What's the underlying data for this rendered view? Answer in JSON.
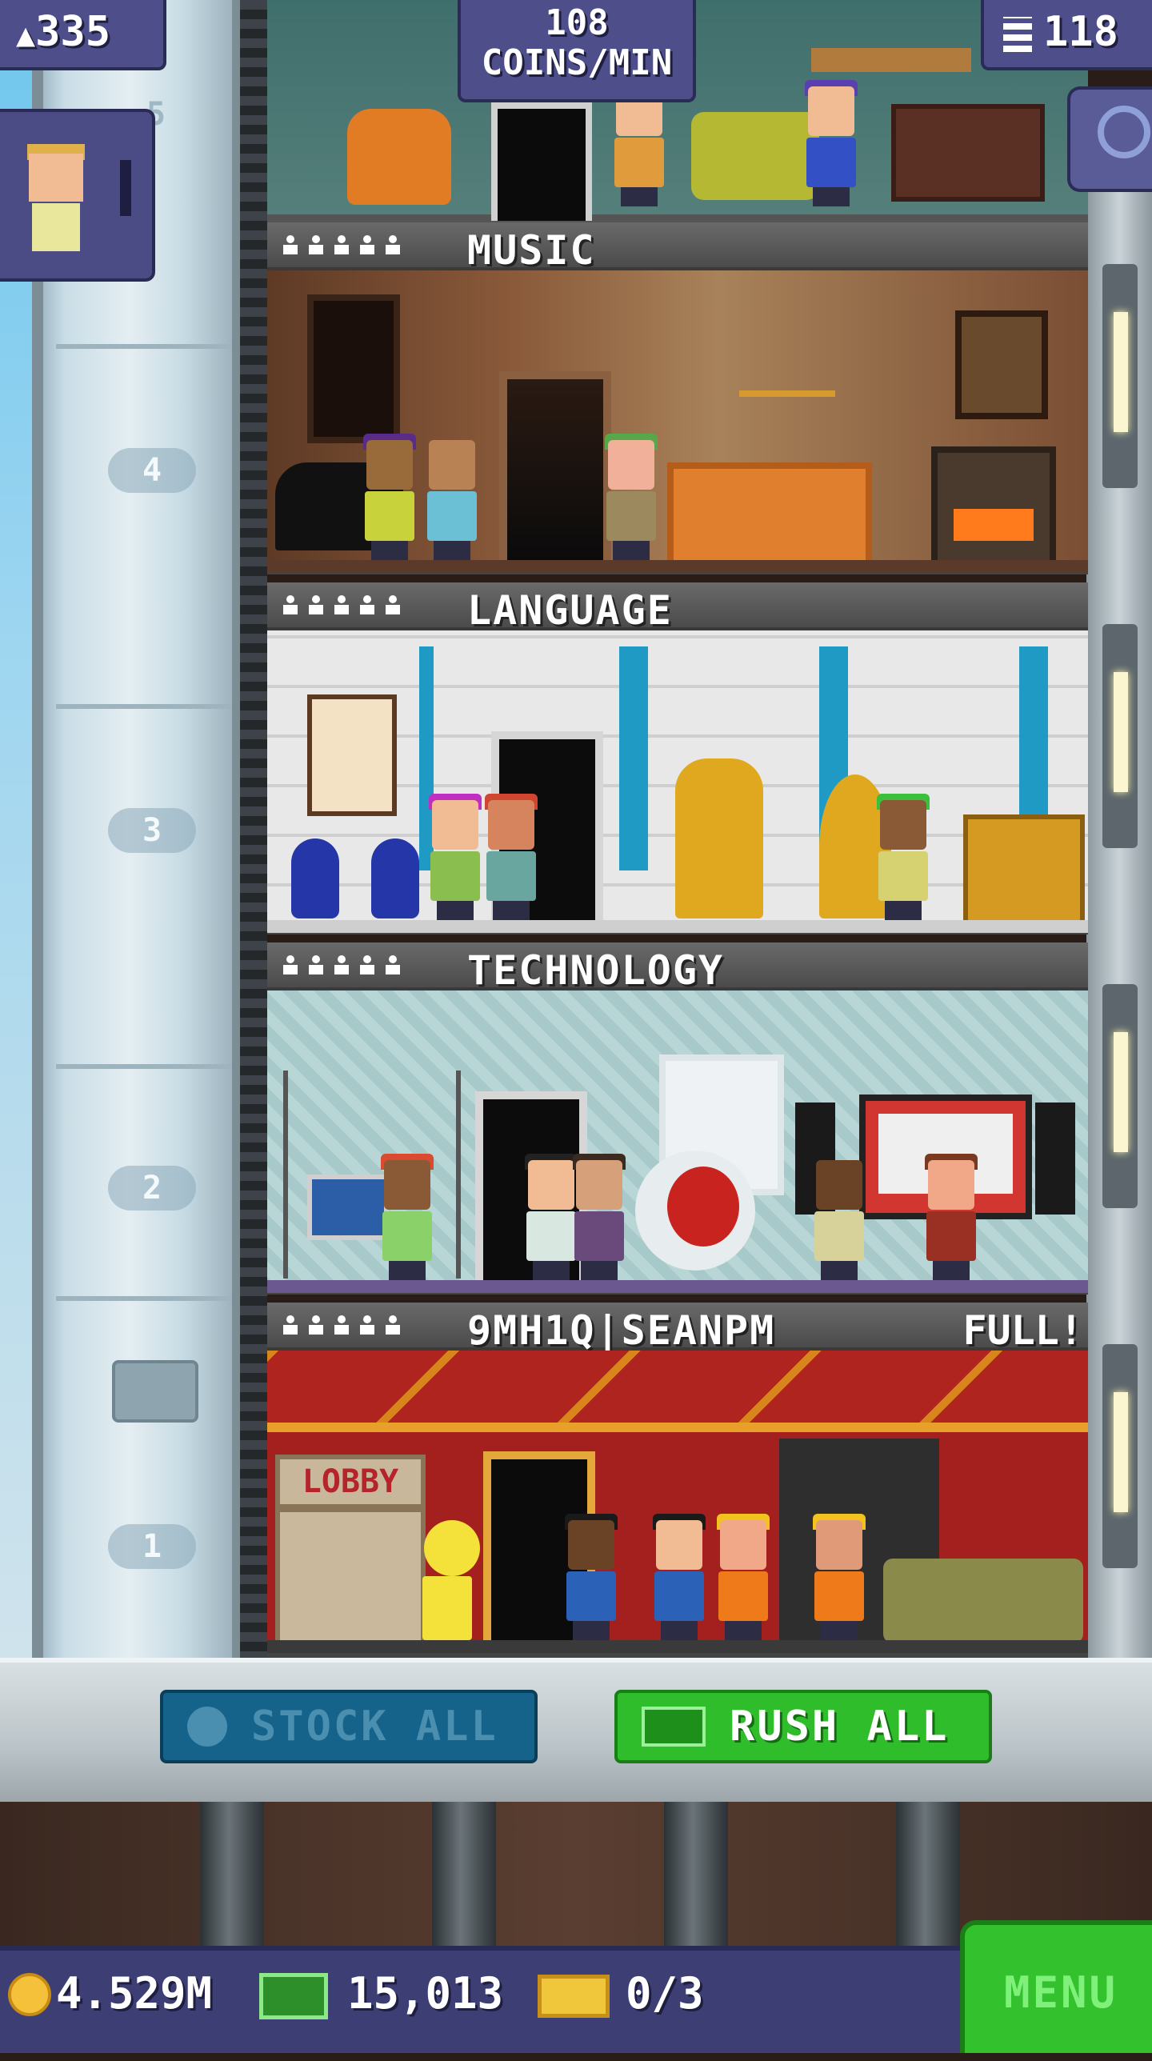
{
  "hud": {
    "population": "335",
    "coins_rate_value": "108",
    "coins_rate_unit": "COINS/MIN",
    "floor_count": "118"
  },
  "elevator": {
    "floor_numbers": [
      "5",
      "4",
      "3",
      "2",
      "1"
    ]
  },
  "floors": [
    {
      "name": "MUSIC",
      "status": ""
    },
    {
      "name": "LANGUAGE",
      "status": ""
    },
    {
      "name": "TECHNOLOGY",
      "status": ""
    },
    {
      "name": "9MH1Q|SEANPM",
      "status": "FULL!"
    }
  ],
  "lobby": {
    "sign": "LOBBY"
  },
  "actions": {
    "stock_all": "STOCK ALL",
    "rush_all": "RUSH ALL"
  },
  "bottom": {
    "coins": "4.529M",
    "bux": "15,013",
    "tickets": "0/3",
    "menu": "MENU"
  },
  "colors": {
    "hud_bg": "#4d4e8a",
    "rush_green": "#2fbd2b",
    "stock_blue": "#15638a",
    "menu_green": "#33c12e"
  }
}
